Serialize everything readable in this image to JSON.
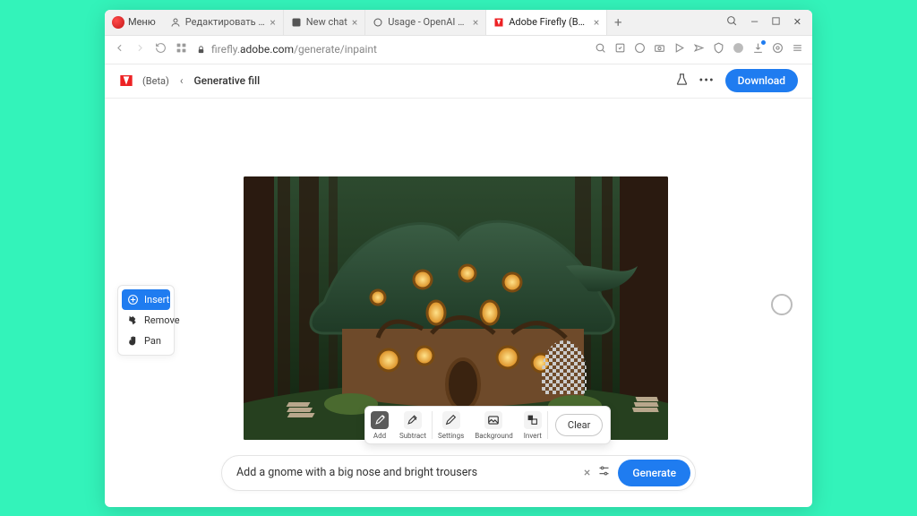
{
  "browser": {
    "menu_label": "Меню",
    "tabs": [
      {
        "label": "Редактировать запись \"M…",
        "fav": "user"
      },
      {
        "label": "New chat",
        "fav": "chat"
      },
      {
        "label": "Usage - OpenAI API",
        "fav": "openai"
      },
      {
        "label": "Adobe Firefly (Beta)",
        "fav": "adobe",
        "active": true
      }
    ],
    "url_prefix": "firefly.",
    "url_bold": "adobe.com",
    "url_suffix": "/generate/inpaint"
  },
  "app": {
    "beta_label": "(Beta)",
    "breadcrumb": "Generative fill",
    "download_label": "Download"
  },
  "modes": {
    "insert": "Insert",
    "remove": "Remove",
    "pan": "Pan"
  },
  "brush": {
    "add": "Add",
    "subtract": "Subtract",
    "settings": "Settings",
    "background": "Background",
    "invert": "Invert",
    "clear": "Clear"
  },
  "prompt": {
    "value": "Add a gnome with a big nose and bright trousers",
    "generate": "Generate"
  }
}
